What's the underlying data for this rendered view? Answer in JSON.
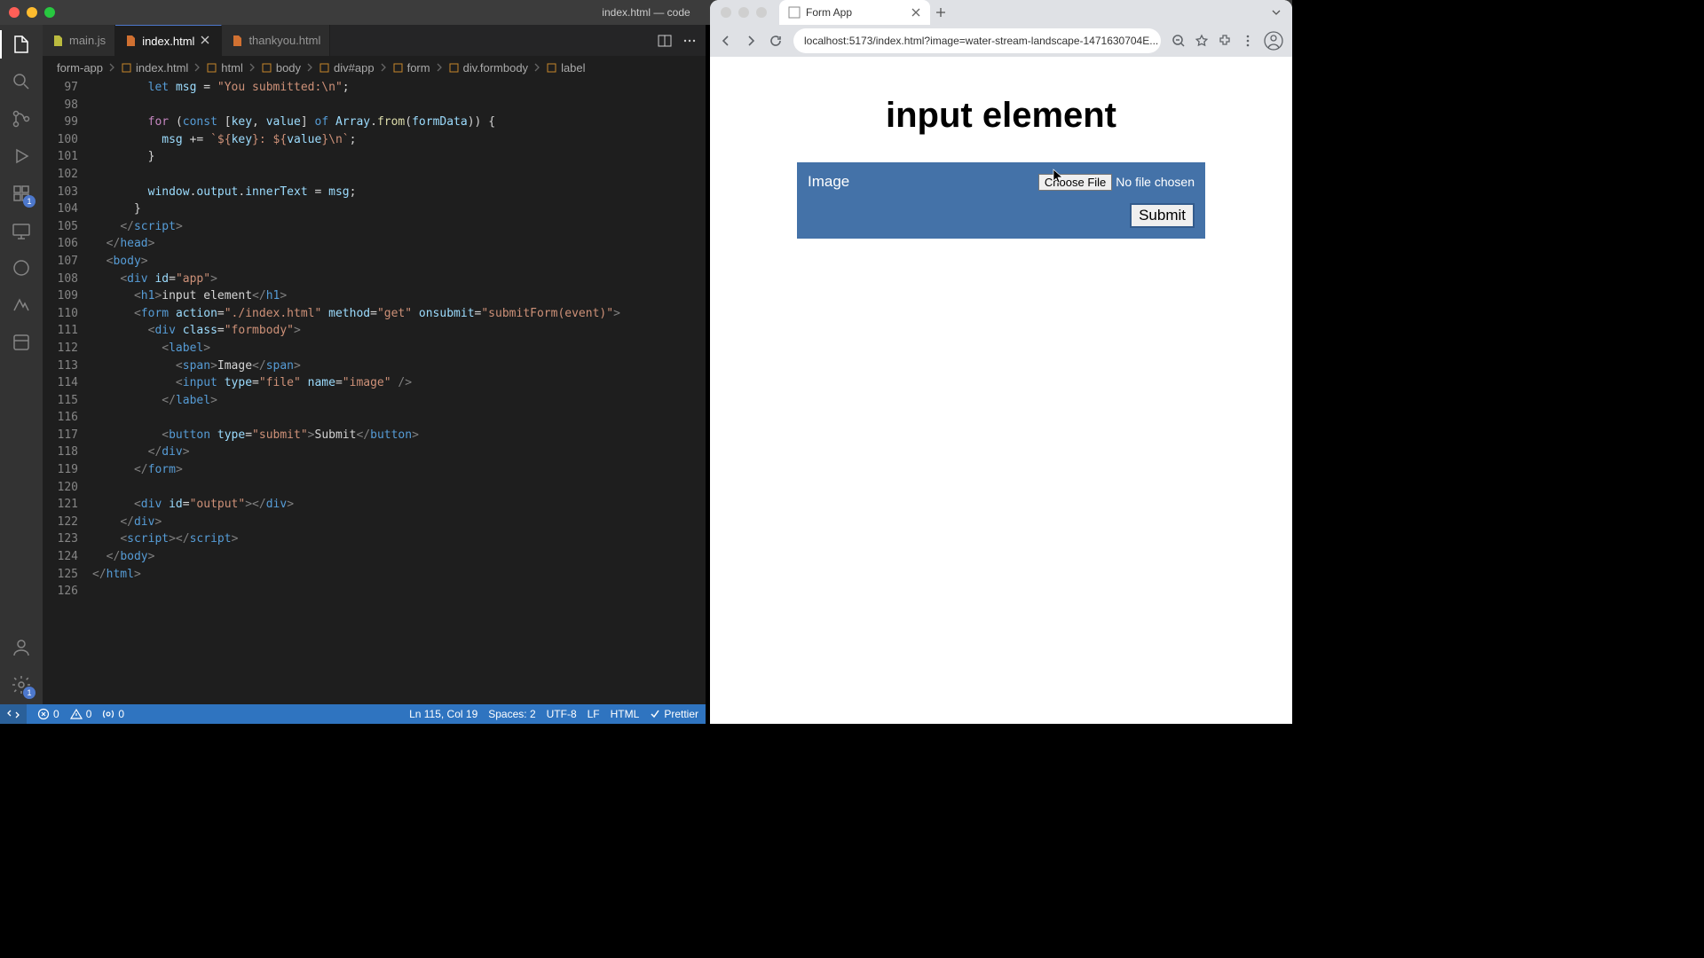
{
  "titlebar": {
    "title": "index.html — code"
  },
  "vscode": {
    "tabs": [
      {
        "icon": "js",
        "label": "main.js",
        "active": false,
        "close": false
      },
      {
        "icon": "html",
        "label": "index.html",
        "active": true,
        "close": true
      },
      {
        "icon": "html",
        "label": "thankyou.html",
        "active": false,
        "close": false
      }
    ],
    "breadcrumbs": [
      {
        "icon": "",
        "label": "form-app"
      },
      {
        "icon": "html",
        "label": "index.html"
      },
      {
        "icon": "sym",
        "label": "html"
      },
      {
        "icon": "sym",
        "label": "body"
      },
      {
        "icon": "sym",
        "label": "div#app"
      },
      {
        "icon": "sym",
        "label": "form"
      },
      {
        "icon": "sym",
        "label": "div.formbody"
      },
      {
        "icon": "sym",
        "label": "label"
      }
    ],
    "activity_badge_ext": "1",
    "activity_badge_gear": "1",
    "statusbar": {
      "errors": "0",
      "warnings": "0",
      "port": "0",
      "cursor": "Ln 115, Col 19",
      "spaces": "Spaces: 2",
      "encoding": "UTF-8",
      "eol": "LF",
      "lang": "HTML",
      "formatter": "Prettier"
    },
    "code_lines": [
      {
        "n": 97,
        "indent": 4,
        "tokens": [
          [
            "kw",
            "let "
          ],
          [
            "var",
            "msg"
          ],
          [
            "op",
            " = "
          ],
          [
            "str",
            "\"You submitted:\\n\""
          ],
          [
            "op",
            ";"
          ]
        ]
      },
      {
        "n": 98,
        "indent": 0,
        "tokens": []
      },
      {
        "n": 99,
        "indent": 4,
        "tokens": [
          [
            "pur",
            "for "
          ],
          [
            "op",
            "("
          ],
          [
            "kw",
            "const "
          ],
          [
            "op",
            "["
          ],
          [
            "var",
            "key"
          ],
          [
            "op",
            ", "
          ],
          [
            "var",
            "value"
          ],
          [
            "op",
            "] "
          ],
          [
            "kw",
            "of "
          ],
          [
            "var",
            "Array"
          ],
          [
            "op",
            "."
          ],
          [
            "fn",
            "from"
          ],
          [
            "op",
            "("
          ],
          [
            "var",
            "formData"
          ],
          [
            "op",
            ")) {"
          ]
        ]
      },
      {
        "n": 100,
        "indent": 5,
        "tokens": [
          [
            "var",
            "msg"
          ],
          [
            "op",
            " += "
          ],
          [
            "str",
            "`${"
          ],
          [
            "var",
            "key"
          ],
          [
            "str",
            "}: ${"
          ],
          [
            "var",
            "value"
          ],
          [
            "str",
            "}\\n`"
          ],
          [
            "op",
            ";"
          ]
        ]
      },
      {
        "n": 101,
        "indent": 4,
        "tokens": [
          [
            "op",
            "}"
          ]
        ]
      },
      {
        "n": 102,
        "indent": 0,
        "tokens": []
      },
      {
        "n": 103,
        "indent": 4,
        "tokens": [
          [
            "var",
            "window"
          ],
          [
            "op",
            "."
          ],
          [
            "var",
            "output"
          ],
          [
            "op",
            "."
          ],
          [
            "var",
            "innerText"
          ],
          [
            "op",
            " = "
          ],
          [
            "var",
            "msg"
          ],
          [
            "op",
            ";"
          ]
        ]
      },
      {
        "n": 104,
        "indent": 3,
        "tokens": [
          [
            "op",
            "}"
          ]
        ]
      },
      {
        "n": 105,
        "indent": 2,
        "tokens": [
          [
            "punc",
            "</"
          ],
          [
            "tag",
            "script"
          ],
          [
            "punc",
            ">"
          ]
        ]
      },
      {
        "n": 106,
        "indent": 1,
        "tokens": [
          [
            "punc",
            "</"
          ],
          [
            "tag",
            "head"
          ],
          [
            "punc",
            ">"
          ]
        ]
      },
      {
        "n": 107,
        "indent": 1,
        "tokens": [
          [
            "punc",
            "<"
          ],
          [
            "tag",
            "body"
          ],
          [
            "punc",
            ">"
          ]
        ]
      },
      {
        "n": 108,
        "indent": 2,
        "tokens": [
          [
            "punc",
            "<"
          ],
          [
            "tag",
            "div "
          ],
          [
            "attr",
            "id"
          ],
          [
            "op",
            "="
          ],
          [
            "str",
            "\"app\""
          ],
          [
            "punc",
            ">"
          ]
        ]
      },
      {
        "n": 109,
        "indent": 3,
        "tokens": [
          [
            "punc",
            "<"
          ],
          [
            "tag",
            "h1"
          ],
          [
            "punc",
            ">"
          ],
          [
            "op",
            "input element"
          ],
          [
            "punc",
            "</"
          ],
          [
            "tag",
            "h1"
          ],
          [
            "punc",
            ">"
          ]
        ]
      },
      {
        "n": 110,
        "indent": 3,
        "tokens": [
          [
            "punc",
            "<"
          ],
          [
            "tag",
            "form "
          ],
          [
            "attr",
            "action"
          ],
          [
            "op",
            "="
          ],
          [
            "str",
            "\"./index.html\""
          ],
          [
            "op",
            " "
          ],
          [
            "attr",
            "method"
          ],
          [
            "op",
            "="
          ],
          [
            "str",
            "\"get\""
          ],
          [
            "op",
            " "
          ],
          [
            "attr",
            "onsubmit"
          ],
          [
            "op",
            "="
          ],
          [
            "str",
            "\"submitForm(event)\""
          ],
          [
            "punc",
            ">"
          ]
        ]
      },
      {
        "n": 111,
        "indent": 4,
        "tokens": [
          [
            "punc",
            "<"
          ],
          [
            "tag",
            "div "
          ],
          [
            "attr",
            "class"
          ],
          [
            "op",
            "="
          ],
          [
            "str",
            "\"formbody\""
          ],
          [
            "punc",
            ">"
          ]
        ]
      },
      {
        "n": 112,
        "indent": 5,
        "tokens": [
          [
            "punc",
            "<"
          ],
          [
            "tag",
            "label"
          ],
          [
            "punc",
            ">"
          ]
        ]
      },
      {
        "n": 113,
        "indent": 6,
        "tokens": [
          [
            "punc",
            "<"
          ],
          [
            "tag",
            "span"
          ],
          [
            "punc",
            ">"
          ],
          [
            "op",
            "Image"
          ],
          [
            "punc",
            "</"
          ],
          [
            "tag",
            "span"
          ],
          [
            "punc",
            ">"
          ]
        ]
      },
      {
        "n": 114,
        "indent": 6,
        "tokens": [
          [
            "punc",
            "<"
          ],
          [
            "tag",
            "input "
          ],
          [
            "attr",
            "type"
          ],
          [
            "op",
            "="
          ],
          [
            "str",
            "\"file\""
          ],
          [
            "op",
            " "
          ],
          [
            "attr",
            "name"
          ],
          [
            "op",
            "="
          ],
          [
            "str",
            "\"image\""
          ],
          [
            "op",
            " "
          ],
          [
            "punc",
            "/>"
          ]
        ]
      },
      {
        "n": 115,
        "indent": 5,
        "tokens": [
          [
            "punc",
            "</"
          ],
          [
            "tag",
            "label"
          ],
          [
            "punc",
            ">"
          ]
        ]
      },
      {
        "n": 116,
        "indent": 0,
        "tokens": []
      },
      {
        "n": 117,
        "indent": 5,
        "tokens": [
          [
            "punc",
            "<"
          ],
          [
            "tag",
            "button "
          ],
          [
            "attr",
            "type"
          ],
          [
            "op",
            "="
          ],
          [
            "str",
            "\"submit\""
          ],
          [
            "punc",
            ">"
          ],
          [
            "op",
            "Submit"
          ],
          [
            "punc",
            "</"
          ],
          [
            "tag",
            "button"
          ],
          [
            "punc",
            ">"
          ]
        ]
      },
      {
        "n": 118,
        "indent": 4,
        "tokens": [
          [
            "punc",
            "</"
          ],
          [
            "tag",
            "div"
          ],
          [
            "punc",
            ">"
          ]
        ]
      },
      {
        "n": 119,
        "indent": 3,
        "tokens": [
          [
            "punc",
            "</"
          ],
          [
            "tag",
            "form"
          ],
          [
            "punc",
            ">"
          ]
        ]
      },
      {
        "n": 120,
        "indent": 0,
        "tokens": []
      },
      {
        "n": 121,
        "indent": 3,
        "tokens": [
          [
            "punc",
            "<"
          ],
          [
            "tag",
            "div "
          ],
          [
            "attr",
            "id"
          ],
          [
            "op",
            "="
          ],
          [
            "str",
            "\"output\""
          ],
          [
            "punc",
            "></"
          ],
          [
            "tag",
            "div"
          ],
          [
            "punc",
            ">"
          ]
        ]
      },
      {
        "n": 122,
        "indent": 2,
        "tokens": [
          [
            "punc",
            "</"
          ],
          [
            "tag",
            "div"
          ],
          [
            "punc",
            ">"
          ]
        ]
      },
      {
        "n": 123,
        "indent": 2,
        "tokens": [
          [
            "punc",
            "<"
          ],
          [
            "tag",
            "script"
          ],
          [
            "punc",
            "></"
          ],
          [
            "tag",
            "script"
          ],
          [
            "punc",
            ">"
          ]
        ]
      },
      {
        "n": 124,
        "indent": 1,
        "tokens": [
          [
            "punc",
            "</"
          ],
          [
            "tag",
            "body"
          ],
          [
            "punc",
            ">"
          ]
        ]
      },
      {
        "n": 125,
        "indent": 0,
        "tokens": [
          [
            "punc",
            "</"
          ],
          [
            "tag",
            "html"
          ],
          [
            "punc",
            ">"
          ]
        ]
      },
      {
        "n": 126,
        "indent": 0,
        "tokens": []
      }
    ]
  },
  "browser": {
    "tab_title": "Form App",
    "url": "localhost:5173/index.html?image=water-stream-landscape-1471630704E...",
    "page": {
      "heading": "input element",
      "label": "Image",
      "choose_btn": "Choose File",
      "file_status": "No file chosen",
      "submit": "Submit"
    }
  }
}
